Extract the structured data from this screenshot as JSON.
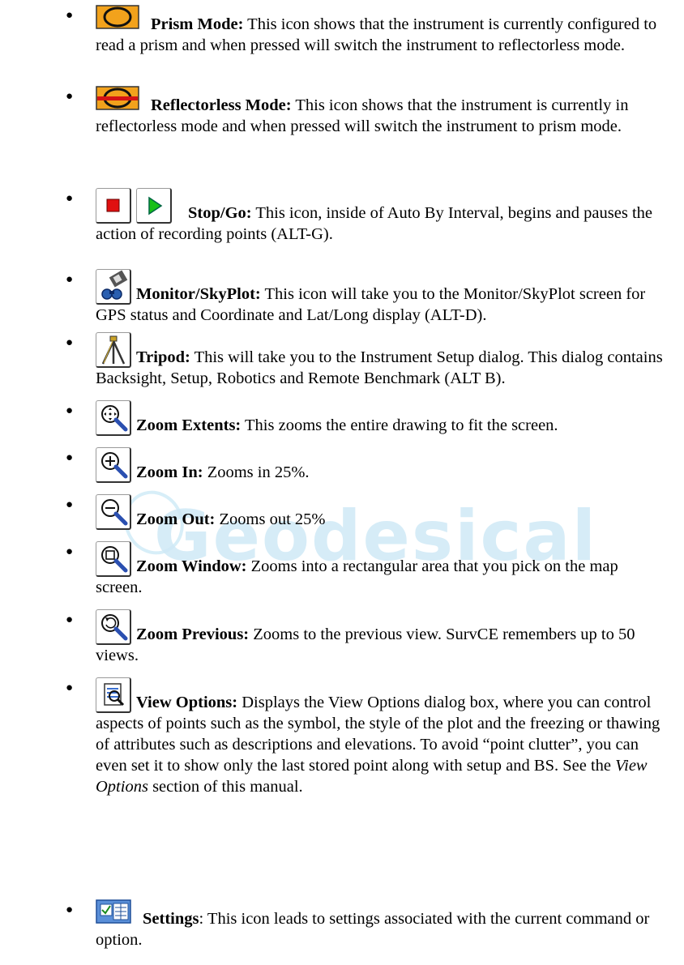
{
  "watermark": "Geodesical",
  "items": [
    {
      "term": "Prism Mode:",
      "text": " This icon shows that the instrument is currently configured to read a prism and when pressed will switch the instrument to reflectorless mode.",
      "icon": "prism-mode-icon"
    },
    {
      "term": "Reflectorless Mode:",
      "text": " This icon shows that the instrument is currently in reflectorless mode and when pressed will switch the instrument to prism mode.",
      "icon": "reflectorless-mode-icon"
    },
    {
      "term": "Stop/Go:",
      "text": " This icon, inside of Auto By Interval, begins and pauses the action of recording points (ALT-G).",
      "icon": "stop-go-icons"
    },
    {
      "term": "Monitor/SkyPlot:",
      "text": " This icon will take you to the Monitor/SkyPlot screen for GPS status and Coordinate and Lat/Long display (ALT-D).",
      "icon": "monitor-skyplot-icon"
    },
    {
      "term": "Tripod:",
      "text": " This will take you to the Instrument Setup dialog. This dialog contains Backsight, Setup, Robotics and Remote Benchmark (ALT B).",
      "icon": "tripod-icon"
    },
    {
      "term": "Zoom Extents:",
      "text": " This zooms the entire drawing to fit the screen.",
      "icon": "zoom-extents-icon"
    },
    {
      "term": "Zoom In:",
      "text": " Zooms in 25%.",
      "icon": "zoom-in-icon"
    },
    {
      "term": "Zoom Out:",
      "text": " Zooms out 25%",
      "icon": "zoom-out-icon"
    },
    {
      "term": "Zoom Window:",
      "text": " Zooms into a rectangular area that you pick on the map screen.",
      "icon": "zoom-window-icon"
    },
    {
      "term": "Zoom Previous:",
      "text": " Zooms to the previous view.  SurvCE remembers up to 50 views.",
      "icon": "zoom-previous-icon"
    },
    {
      "term": "View Options:",
      "text_a": " Displays the View Options dialog box, where you can control aspects of points such as the symbol, the style of the plot and the freezing or thawing of attributes such as descriptions and elevations.  To avoid “point clutter”, you can even set it to show only the last stored point along with setup and BS. See the ",
      "text_em": "View Options",
      "text_b": " section of this manual.",
      "icon": "view-options-icon"
    },
    {
      "term": "Settings",
      "text": ":  This icon leads to settings associated with the current command or option.",
      "icon": "settings-icon"
    }
  ]
}
